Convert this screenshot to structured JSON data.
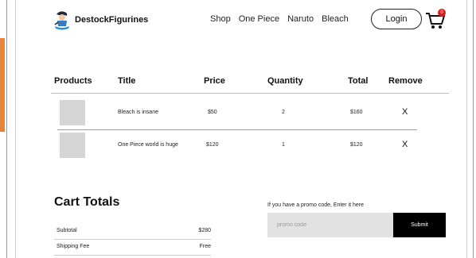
{
  "header": {
    "brand_name": "DestockFigurines",
    "logo_icon": "figurine-logo-icon",
    "nav": [
      "Shop",
      "One Piece",
      "Naruto",
      "Bleach"
    ],
    "login_label": "Login",
    "cart_icon": "shopping-cart-icon",
    "cart_badge": "0"
  },
  "cart_table": {
    "headers": [
      "Products",
      "Title",
      "Price",
      "Quantity",
      "Total",
      "Remove"
    ],
    "rows": [
      {
        "title": "Bleach is insane",
        "price": "$50",
        "quantity": "2",
        "total": "$160",
        "remove": "X"
      },
      {
        "title": "One Piece world is huge",
        "price": "$120",
        "quantity": "1",
        "total": "$120",
        "remove": "X"
      }
    ]
  },
  "cart_totals": {
    "title": "Cart Totals",
    "subtotal_label": "Subtotal",
    "subtotal_value": "$280",
    "shipping_label": "Shipping Fee",
    "shipping_value": "Free"
  },
  "promo": {
    "label": "If you have a promo code, Enter it here",
    "placeholder": "promo code",
    "submit_label": "Submit"
  },
  "colors": {
    "accent_black": "#000000",
    "badge_red": "#e01b1b",
    "placeholder_gray": "#d5d5d5",
    "input_bg": "#e2e2e2"
  }
}
